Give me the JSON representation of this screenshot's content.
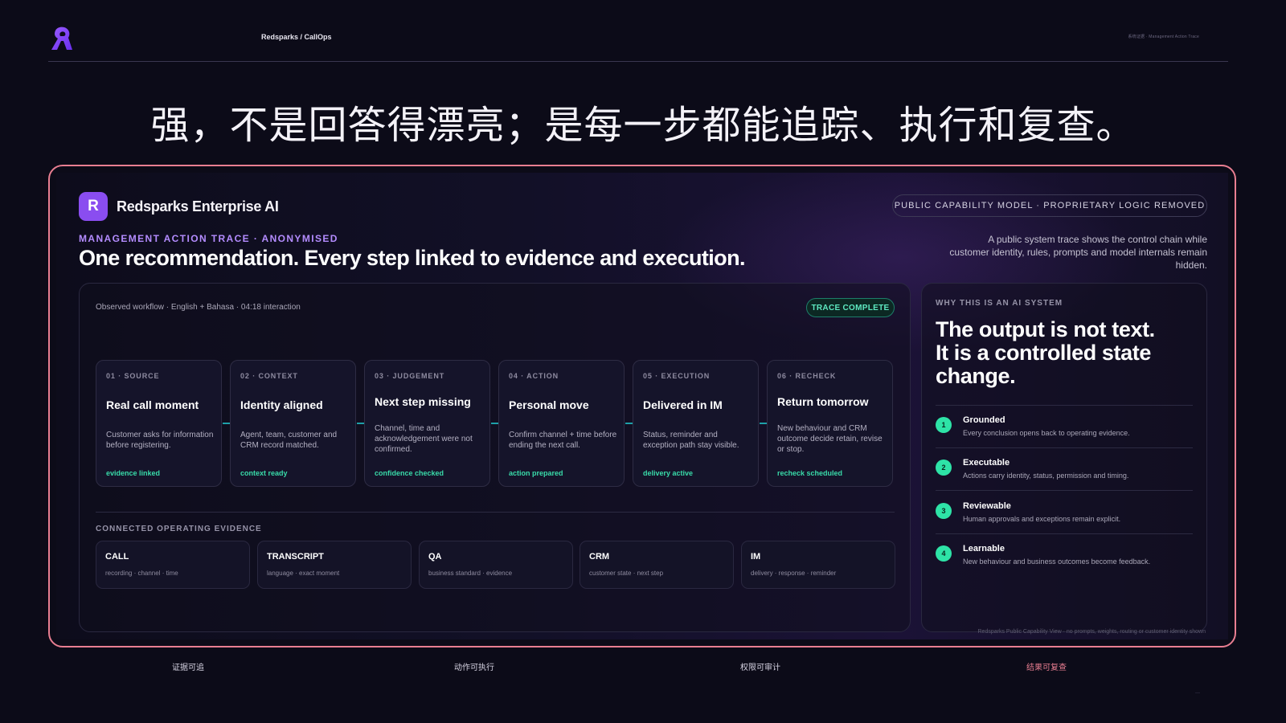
{
  "header": {
    "breadcrumb": "Redsparks / CallOps",
    "top_right": "系统证据 · Management Action Trace",
    "headline": "强，不是回答得漂亮；是每一步都能追踪、执行和复查。"
  },
  "brand": {
    "mark": "R",
    "name": "Redsparks Enterprise AI",
    "pill": "PUBLIC CAPABILITY MODEL · PROPRIETARY LOGIC REMOVED"
  },
  "intro": {
    "kicker": "MANAGEMENT ACTION TRACE · ANONYMISED",
    "title": "One recommendation. Every step linked to evidence and execution.",
    "description": "A public system trace shows the control chain while customer identity, rules, prompts and model internals remain hidden."
  },
  "trace": {
    "observed": "Observed workflow · English + Bahasa · 04:18 interaction",
    "badge": "TRACE COMPLETE",
    "steps": [
      {
        "step": "01 · SOURCE",
        "title": "Real call moment",
        "desc": "Customer asks for information before registering.",
        "status": "evidence linked"
      },
      {
        "step": "02 · CONTEXT",
        "title": "Identity aligned",
        "desc": "Agent, team, customer and CRM record matched.",
        "status": "context ready"
      },
      {
        "step": "03 · JUDGEMENT",
        "title": "Next step missing",
        "desc": "Channel, time and acknowledgement were not confirmed.",
        "status": "confidence checked"
      },
      {
        "step": "04 · ACTION",
        "title": "Personal move",
        "desc": "Confirm channel + time before ending the next call.",
        "status": "action prepared"
      },
      {
        "step": "05 · EXECUTION",
        "title": "Delivered in IM",
        "desc": "Status, reminder and exception path stay visible.",
        "status": "delivery active"
      },
      {
        "step": "06 · RECHECK",
        "title": "Return tomorrow",
        "desc": "New behaviour and CRM outcome decide retain, revise or stop.",
        "status": "recheck scheduled"
      }
    ],
    "evidence_label": "CONNECTED OPERATING EVIDENCE",
    "evidence": [
      {
        "title": "CALL",
        "sub": "recording · channel · time"
      },
      {
        "title": "TRANSCRIPT",
        "sub": "language · exact moment"
      },
      {
        "title": "QA",
        "sub": "business standard · evidence"
      },
      {
        "title": "CRM",
        "sub": "customer state · next step"
      },
      {
        "title": "IM",
        "sub": "delivery · response · reminder"
      }
    ]
  },
  "why": {
    "label": "WHY THIS IS AN AI SYSTEM",
    "big_line1": "The output is not text.",
    "big_line2": "It is a controlled state",
    "big_line3": "change.",
    "items": [
      {
        "num": "1",
        "title": "Grounded",
        "sub": "Every conclusion opens back to operating evidence."
      },
      {
        "num": "2",
        "title": "Executable",
        "sub": "Actions carry identity, status, permission and timing."
      },
      {
        "num": "3",
        "title": "Reviewable",
        "sub": "Human approvals and exceptions remain explicit."
      },
      {
        "num": "4",
        "title": "Learnable",
        "sub": "New behaviour and business outcomes become feedback."
      }
    ],
    "footnote": "Redsparks Public Capability View · no prompts, weights, routing or customer identity shown"
  },
  "bottom": {
    "labels": [
      "证据可追",
      "动作可执行",
      "权限可审计",
      "结果可复查"
    ],
    "tiny_mark": "—"
  },
  "colors": {
    "background": "#0c0b18",
    "frame_border": "#e87e91",
    "accent_purple": "#8a4df0",
    "kicker_purple": "#b48cff",
    "status_green": "#39dba9",
    "badge_green": "#5ee9c1",
    "highlight_label": "#e87e91"
  },
  "icons": {
    "logo": "redsparks-r-logo-icon"
  }
}
